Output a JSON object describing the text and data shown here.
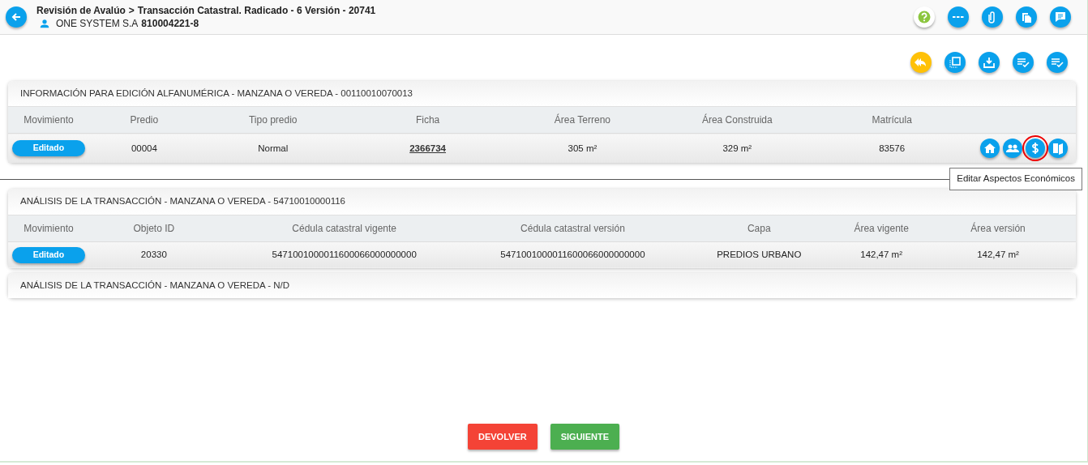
{
  "header": {
    "breadcrumb": "Revisión de Avalúo",
    "separator": ">",
    "title": "Transacción Catastral. Radicado - 6 Versión - 20741",
    "company": "ONE SYSTEM S.A",
    "nit": "810004221-8"
  },
  "header_actions": [
    {
      "kind": "help",
      "color": "#8cc63f"
    },
    {
      "kind": "more",
      "color": "#0aa1ec"
    },
    {
      "kind": "attach",
      "color": "#0aa1ec"
    },
    {
      "kind": "copy",
      "color": "#0aa1ec"
    },
    {
      "kind": "comment",
      "color": "#0aa1ec"
    }
  ],
  "toolbar_actions": [
    {
      "kind": "reply",
      "color": "#ffc107"
    },
    {
      "kind": "layers",
      "color": "#0aa1ec"
    },
    {
      "kind": "download",
      "color": "#0aa1ec"
    },
    {
      "kind": "checklist",
      "color": "#0aa1ec"
    },
    {
      "kind": "checklist",
      "color": "#0aa1ec"
    }
  ],
  "panels": [
    {
      "title": "INFORMACIÓN PARA EDICIÓN ALFANUMÉRICA - MANZANA O VEREDA - 00110010070013",
      "columns": [
        "Movimiento",
        "Predio",
        "Tipo predio",
        "Ficha",
        "Área Terreno",
        "Área Construida",
        "Matrícula"
      ],
      "rows": [
        {
          "cells": [
            "Editado",
            "00004",
            "Normal",
            "2366734",
            "305 m²",
            "329 m²",
            "83576"
          ],
          "actions": [
            {
              "kind": "home",
              "highlighted": false
            },
            {
              "kind": "people",
              "highlighted": false
            },
            {
              "kind": "dollar",
              "highlighted": true,
              "tooltip": "Editar Aspectos Económicos"
            },
            {
              "kind": "book",
              "highlighted": false
            }
          ]
        }
      ]
    },
    {
      "title": "ANÁLISIS DE LA TRANSACCIÓN - MANZANA O VEREDA - 54710010000116",
      "columns": [
        "Movimiento",
        "Objeto ID",
        "Cédula catastral vigente",
        "Cédula catastral versión",
        "Capa",
        "Área vigente",
        "Área versión"
      ],
      "rows": [
        {
          "cells": [
            "Editado",
            "20330",
            "5471001000011600066000000000",
            "5471001000011600066000000000",
            "PREDIOS URBANO",
            "142,47 m²",
            "142,47 m²"
          ]
        }
      ]
    },
    {
      "title": "ANÁLISIS DE LA TRANSACCIÓN - MANZANA O VEREDA - N/D"
    }
  ],
  "footer_buttons": [
    {
      "label": "DEVOLVER",
      "kind": "danger"
    },
    {
      "label": "SIGUIENTE",
      "kind": "success"
    }
  ]
}
